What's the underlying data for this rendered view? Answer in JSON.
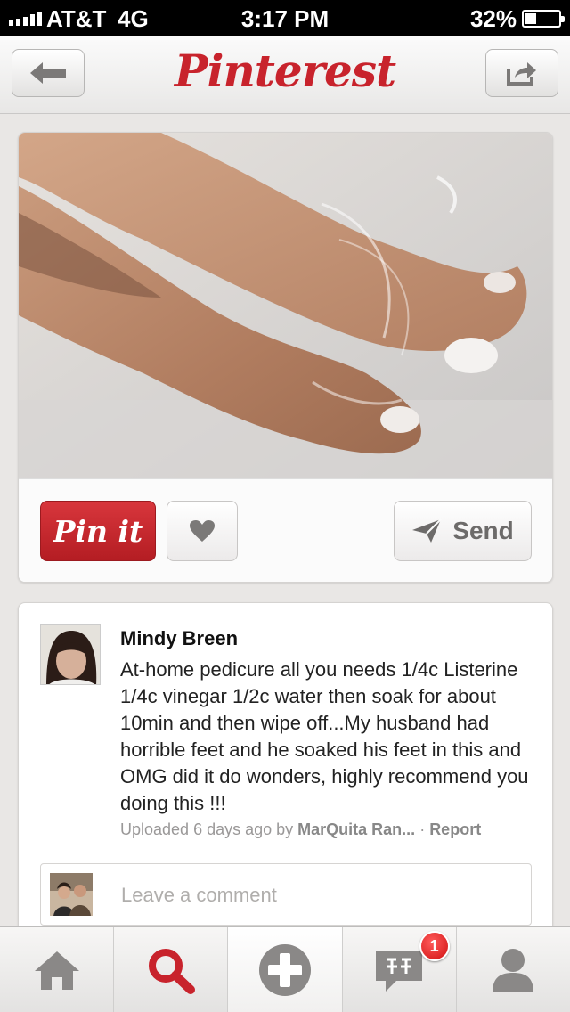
{
  "status_bar": {
    "carrier": "AT&T",
    "network": "4G",
    "time": "3:17 PM",
    "battery": "32%",
    "battery_level": 0.32
  },
  "navbar": {
    "logo": "Pinterest",
    "back_icon": "back-arrow-icon",
    "share_icon": "share-icon"
  },
  "pin": {
    "image_alt": "feet soaking in water",
    "actions": {
      "pin_it_label": "Pin it",
      "like_icon": "heart-icon",
      "send_label": "Send"
    }
  },
  "description": {
    "author": "Mindy Breen",
    "text": "At-home pedicure all you needs 1/4c Listerine 1/4c vinegar 1/2c water then soak for about 10min and then wipe off...My husband had horrible feet and he soaked his feet in this and OMG did it do wonders, highly recommend you doing this  !!!",
    "uploaded_prefix": "Uploaded 6 days ago by ",
    "uploader": "MarQuita Ran...",
    "separator": " · ",
    "report_label": "Report"
  },
  "comment": {
    "placeholder": "Leave a comment"
  },
  "tabbar": {
    "tabs": [
      {
        "icon": "home-icon"
      },
      {
        "icon": "search-icon"
      },
      {
        "icon": "add-icon"
      },
      {
        "icon": "notifications-icon",
        "badge": "1"
      },
      {
        "icon": "profile-icon"
      }
    ]
  },
  "colors": {
    "brand_red": "#c8232c",
    "background": "#e9e7e5"
  }
}
